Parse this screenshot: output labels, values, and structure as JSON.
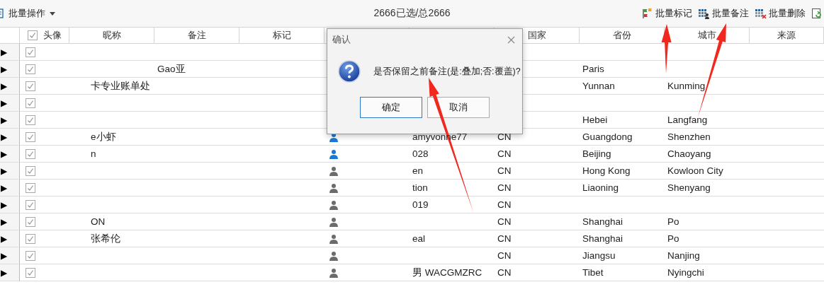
{
  "toolbar": {
    "menu": "批量操作",
    "selection": "2666已选/总2666",
    "actions": [
      {
        "kind": "flag",
        "label": "批量标记"
      },
      {
        "kind": "note",
        "label": "批量备注"
      },
      {
        "kind": "delete",
        "label": "批量删除"
      },
      {
        "kind": "refresh"
      }
    ]
  },
  "table": {
    "header_checked": true,
    "columns": [
      "头像",
      "昵称",
      "备注",
      "标记",
      "国家",
      "省份",
      "城市",
      "来源"
    ],
    "rows": [
      {
        "expander": "▶",
        "checked": true
      },
      {
        "expander": "▶",
        "checked": true,
        "remark": "Gao亚",
        "province": "Paris"
      },
      {
        "expander": "▶",
        "checked": true,
        "nickname": "卡专业账单处",
        "province": "Yunnan",
        "city": "Kunming"
      },
      {
        "expander": "▶",
        "checked": true
      },
      {
        "expander": "▶",
        "checked": true,
        "province": "Hebei",
        "city": "Langfang"
      },
      {
        "expander": "▶",
        "checked": true,
        "nickname": "e小虾",
        "column_6": {
          "color": "#1a78d2"
        },
        "column_7": "amyvonne77",
        "country": "CN",
        "province": "Guangdong",
        "city": "Shenzhen"
      },
      {
        "expander": "▶",
        "checked": true,
        "nickname": "n",
        "column_6": {
          "color": "#1a78d2"
        },
        "column_7": "028",
        "country": "CN",
        "province": "Beijing",
        "city": "Chaoyang"
      },
      {
        "expander": "▶",
        "checked": true,
        "column_6": {
          "color": "#6b6b6b"
        },
        "column_7": "en",
        "country": "CN",
        "province": "Hong Kong",
        "city": "Kowloon City"
      },
      {
        "expander": "▶",
        "checked": true,
        "column_6": {
          "color": "#6b6b6b"
        },
        "column_7": "tion",
        "country": "CN",
        "province": "Liaoning",
        "city": "Shenyang"
      },
      {
        "expander": "▶",
        "checked": true,
        "column_6": {
          "color": "#6b6b6b"
        },
        "column_7": "019",
        "country": "CN"
      },
      {
        "expander": "▶",
        "checked": true,
        "nickname": "ON",
        "column_6": {
          "color": "#6b6b6b"
        },
        "country": "CN",
        "province": "Shanghai",
        "city": "Po"
      },
      {
        "expander": "▶",
        "checked": true,
        "nickname": "张希伦",
        "column_6": {
          "color": "#6b6b6b"
        },
        "column_7": "eal",
        "country": "CN",
        "province": "Shanghai",
        "city": "Po"
      },
      {
        "expander": "▶",
        "checked": true,
        "column_6": {
          "color": "#6b6b6b"
        },
        "country": "CN",
        "province": "Jiangsu",
        "city": "Nanjing"
      },
      {
        "expander": "▶",
        "checked": true,
        "column_6": {
          "color": "#6b6b6b"
        },
        "column_7": "男 WACGMZRC",
        "country": "CN",
        "province": "Tibet",
        "city": "Nyingchi"
      }
    ]
  },
  "dialog": {
    "title": "确认",
    "message": "是否保留之前备注(是:叠加;否:覆盖)?",
    "buttons": [
      {
        "label": "确定",
        "selected": true
      },
      {
        "label": "取消",
        "selected": false
      }
    ]
  }
}
